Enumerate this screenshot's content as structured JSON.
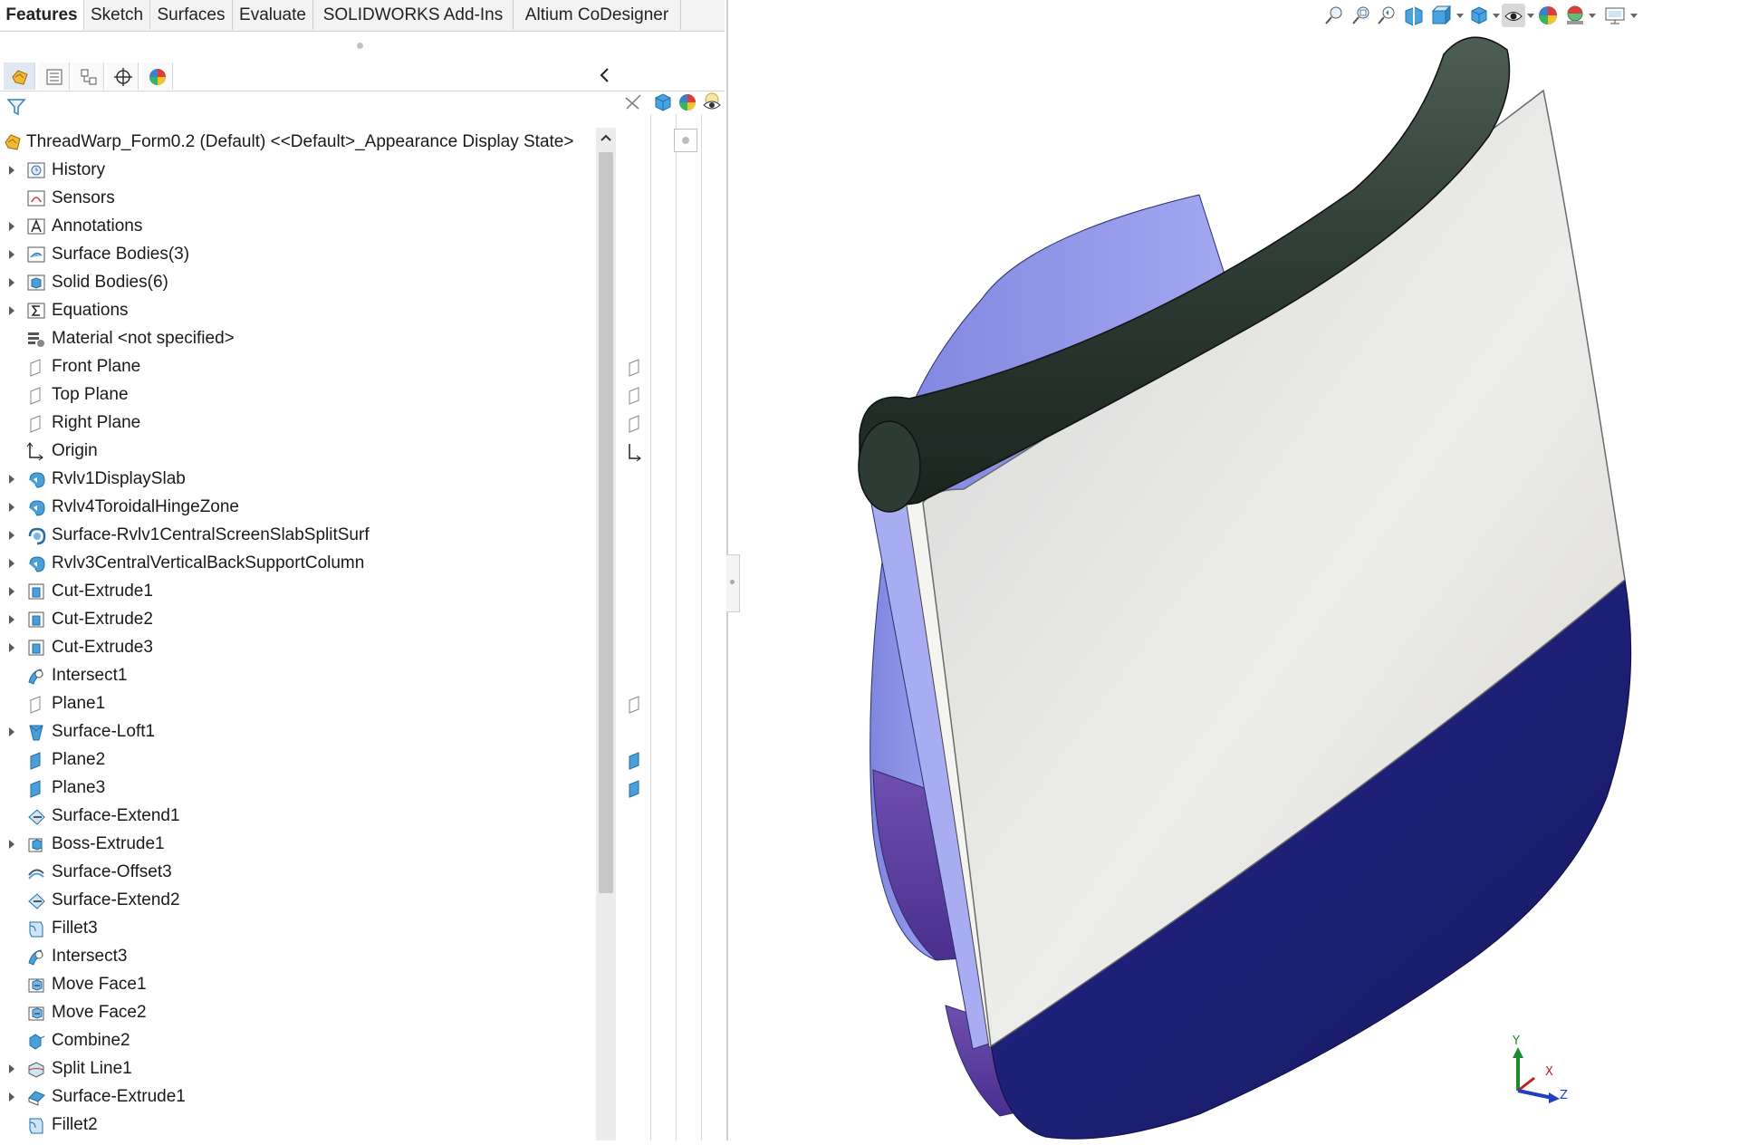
{
  "command_tabs": [
    {
      "label": "Features",
      "active": true
    },
    {
      "label": "Sketch",
      "active": false
    },
    {
      "label": "Surfaces",
      "active": false
    },
    {
      "label": "Evaluate",
      "active": false
    },
    {
      "label": "SOLIDWORKS Add-Ins",
      "active": false
    },
    {
      "label": "Altium CoDesigner",
      "active": false
    }
  ],
  "manager_tabs": [
    "feature-manager-icon",
    "property-manager-icon",
    "configuration-manager-icon",
    "dimxpert-manager-icon",
    "display-manager-icon"
  ],
  "tree_root": {
    "label": "ThreadWarp_Form0.2 (Default) <<Default>_Appearance Display State>"
  },
  "tree_items": [
    {
      "label": "History",
      "expandable": true,
      "icon": "history-icon"
    },
    {
      "label": "Sensors",
      "expandable": false,
      "icon": "sensors-icon"
    },
    {
      "label": "Annotations",
      "expandable": true,
      "icon": "annotations-icon"
    },
    {
      "label": "Surface Bodies(3)",
      "expandable": true,
      "icon": "surface-bodies-icon"
    },
    {
      "label": "Solid Bodies(6)",
      "expandable": true,
      "icon": "solid-bodies-icon"
    },
    {
      "label": "Equations",
      "expandable": true,
      "icon": "equations-icon"
    },
    {
      "label": "Material <not specified>",
      "expandable": false,
      "icon": "material-icon"
    },
    {
      "label": "Front Plane",
      "expandable": false,
      "icon": "plane-icon"
    },
    {
      "label": "Top Plane",
      "expandable": false,
      "icon": "plane-icon"
    },
    {
      "label": "Right Plane",
      "expandable": false,
      "icon": "plane-icon"
    },
    {
      "label": "Origin",
      "expandable": false,
      "icon": "origin-icon"
    },
    {
      "label": "Rvlv1DisplaySlab",
      "expandable": true,
      "icon": "revolve-icon"
    },
    {
      "label": "Rvlv4ToroidalHingeZone",
      "expandable": true,
      "icon": "revolve-icon"
    },
    {
      "label": "Surface-Rvlv1CentralScreenSlabSplitSurf",
      "expandable": true,
      "icon": "surface-revolve-icon"
    },
    {
      "label": "Rvlv3CentralVerticalBackSupportColumn",
      "expandable": true,
      "icon": "revolve-icon"
    },
    {
      "label": "Cut-Extrude1",
      "expandable": true,
      "icon": "cut-extrude-icon"
    },
    {
      "label": "Cut-Extrude2",
      "expandable": true,
      "icon": "cut-extrude-icon"
    },
    {
      "label": "Cut-Extrude3",
      "expandable": true,
      "icon": "cut-extrude-icon"
    },
    {
      "label": "Intersect1",
      "expandable": false,
      "icon": "intersect-icon"
    },
    {
      "label": "Plane1",
      "expandable": false,
      "icon": "plane-icon"
    },
    {
      "label": "Surface-Loft1",
      "expandable": true,
      "icon": "surface-loft-icon"
    },
    {
      "label": "Plane2",
      "expandable": false,
      "icon": "plane-filled-icon"
    },
    {
      "label": "Plane3",
      "expandable": false,
      "icon": "plane-filled-icon"
    },
    {
      "label": "Surface-Extend1",
      "expandable": false,
      "icon": "surface-extend-icon"
    },
    {
      "label": "Boss-Extrude1",
      "expandable": true,
      "icon": "boss-extrude-icon"
    },
    {
      "label": "Surface-Offset3",
      "expandable": false,
      "icon": "surface-offset-icon"
    },
    {
      "label": "Surface-Extend2",
      "expandable": false,
      "icon": "surface-extend-icon"
    },
    {
      "label": "Fillet3",
      "expandable": false,
      "icon": "fillet-icon"
    },
    {
      "label": "Intersect3",
      "expandable": false,
      "icon": "intersect-icon"
    },
    {
      "label": "Move Face1",
      "expandable": false,
      "icon": "move-face-icon"
    },
    {
      "label": "Move Face2",
      "expandable": false,
      "icon": "move-face-icon"
    },
    {
      "label": "Combine2",
      "expandable": false,
      "icon": "combine-icon"
    },
    {
      "label": "Split Line1",
      "expandable": true,
      "icon": "split-line-icon"
    },
    {
      "label": "Surface-Extrude1",
      "expandable": true,
      "icon": "surface-extrude-icon"
    },
    {
      "label": "Fillet2",
      "expandable": false,
      "icon": "fillet-icon"
    }
  ],
  "heads_up_toolbar": [
    "zoom-to-fit-icon",
    "zoom-to-area-icon",
    "previous-view-icon",
    "section-view-icon",
    "view-orientation-icon",
    "display-style-icon",
    "hide-show-items-icon",
    "edit-appearance-icon",
    "apply-scene-icon",
    "view-settings-icon"
  ],
  "triad_axes": {
    "y": "Y",
    "x": "X",
    "z": "Z"
  },
  "colors": {
    "accent_blue": "#3b82c4",
    "plane_blue": "#4a9fd8",
    "model_navy": "#1f227a",
    "model_lavender": "#8e94e6",
    "model_screen": "#e6e6e4",
    "model_rod": "#2c3b33"
  }
}
